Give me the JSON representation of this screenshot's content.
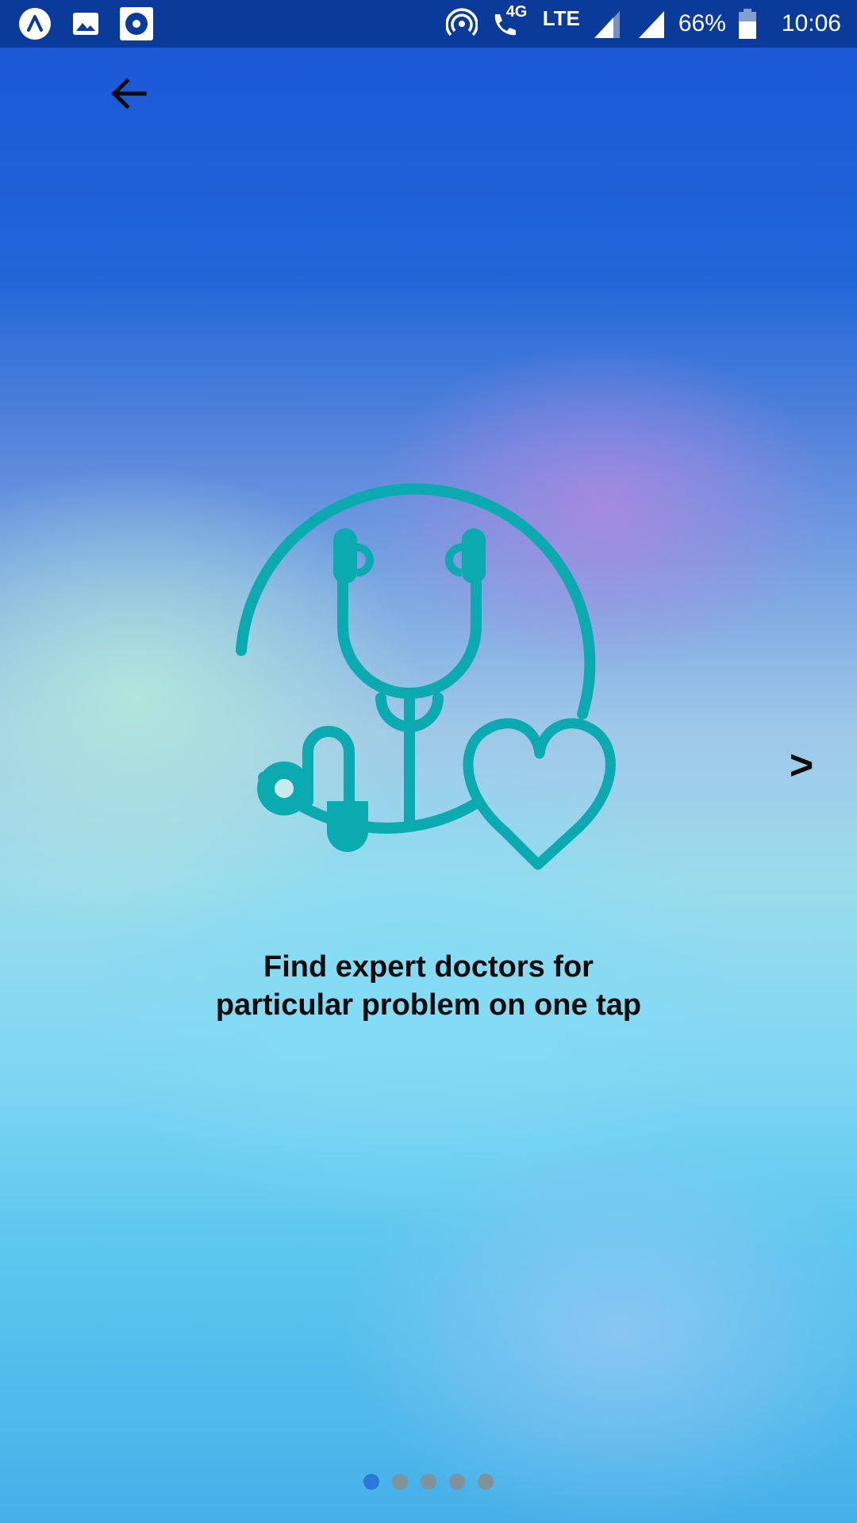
{
  "status_bar": {
    "battery": "66%",
    "time": "10:06",
    "network_label": "LTE",
    "call_network": "4G",
    "left_icons": [
      "app-a-icon",
      "image-icon",
      "record-icon"
    ],
    "right_icons": [
      "hotspot-icon",
      "wifi-call-icon",
      "signal-icon",
      "battery-icon"
    ]
  },
  "nav": {
    "back_icon": "arrow-left-icon",
    "next_label": ">"
  },
  "slide": {
    "illustration_icon": "stethoscope-heart-icon",
    "caption_line1": "Find expert doctors for",
    "caption_line2": "particular problem on one tap"
  },
  "pager": {
    "total": 5,
    "active_index": 0
  },
  "colors": {
    "status_bar": "#0a3a9a",
    "illustration": "#0aaab0",
    "dot_active": "#2a78d8",
    "dot_inactive": "#8c8c8c"
  }
}
